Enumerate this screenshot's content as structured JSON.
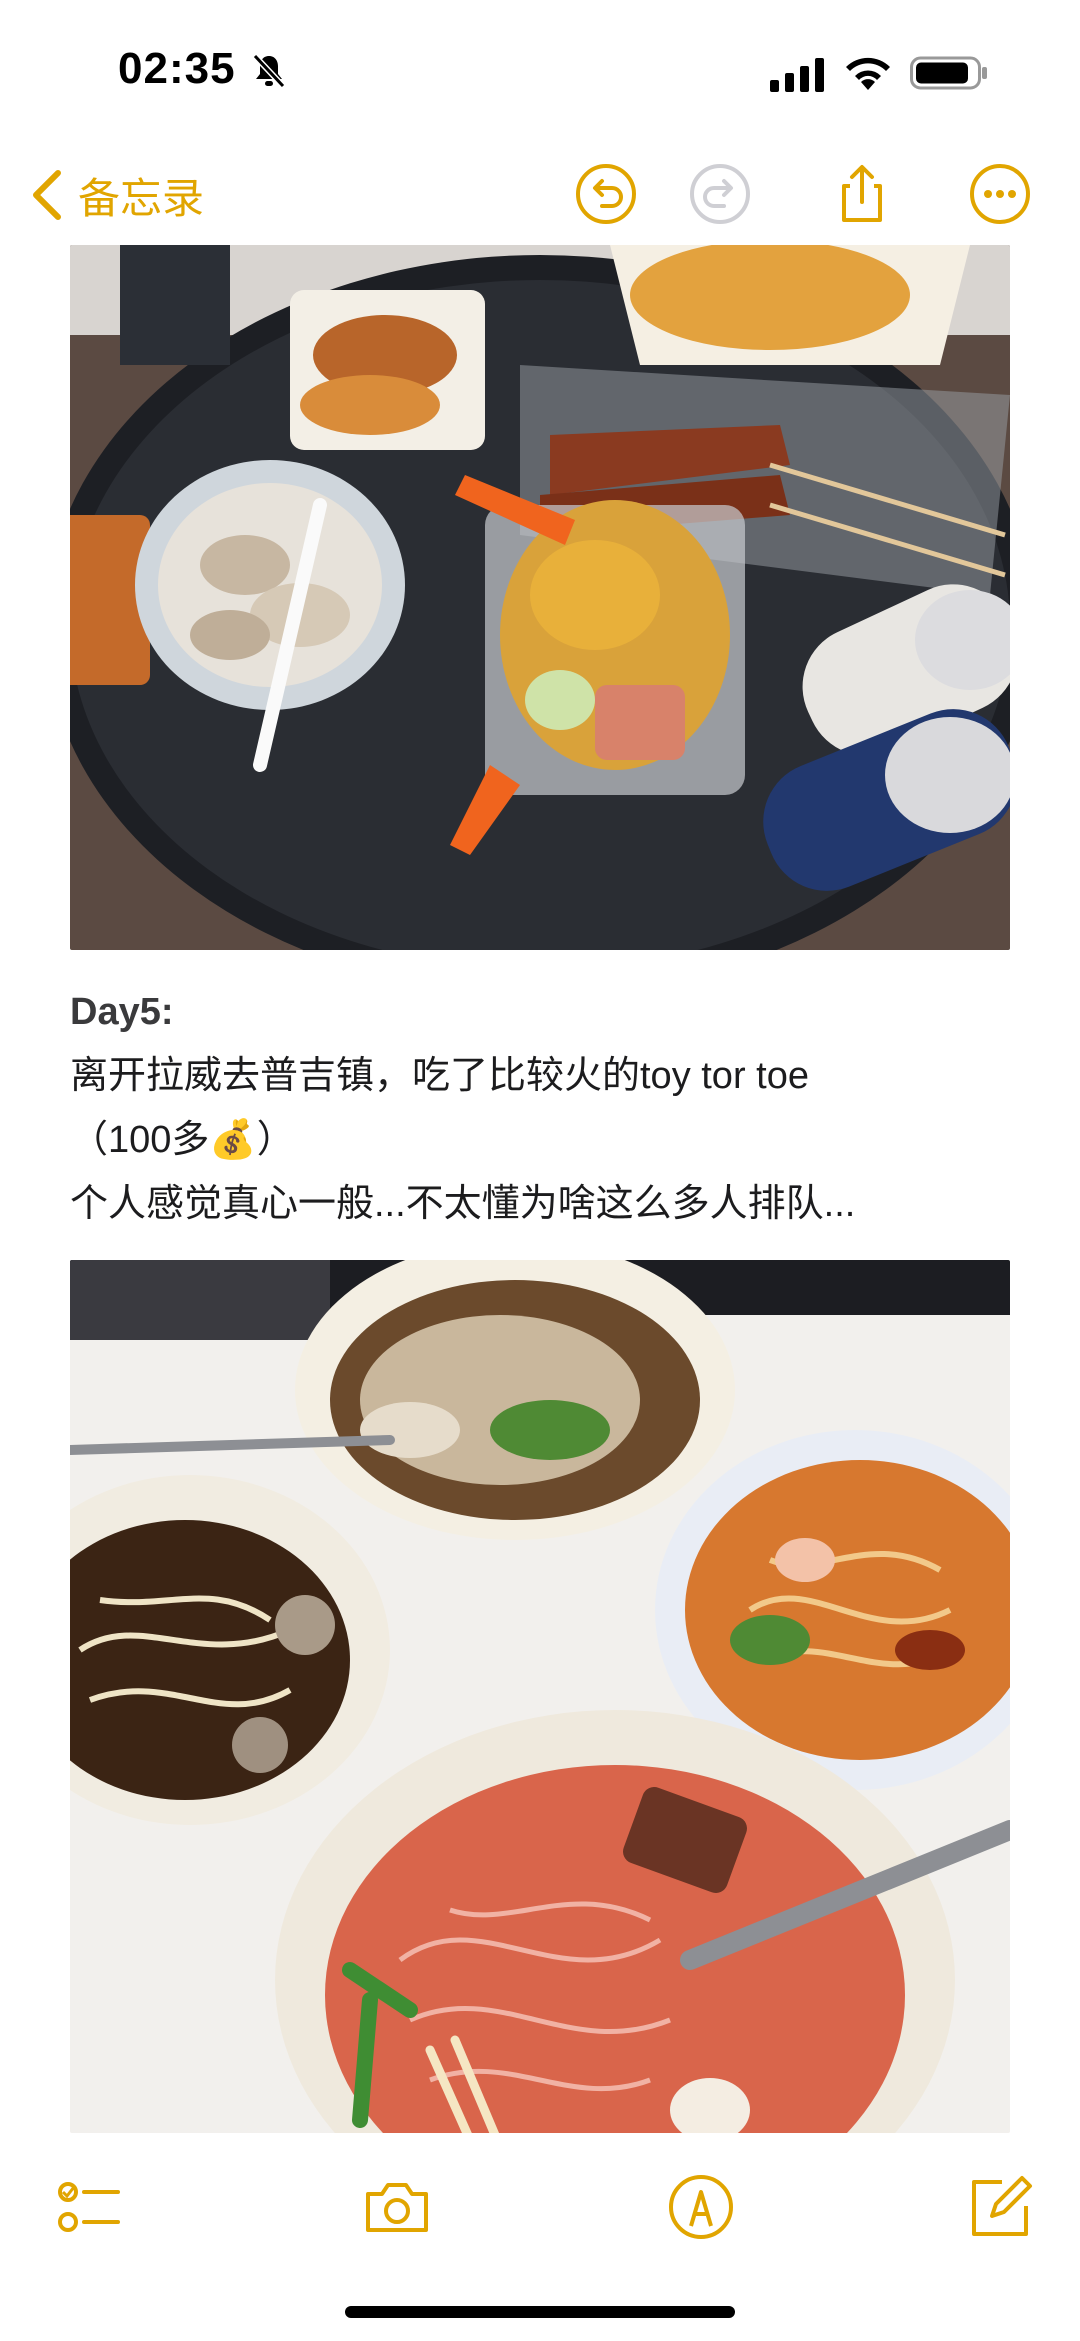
{
  "status_bar": {
    "time": "02:35"
  },
  "nav": {
    "back_label": "备忘录"
  },
  "note": {
    "heading": "Day5:",
    "line1": "离开拉威去普吉镇，吃了比较火的toy tor toe",
    "line2": "（100多💰）",
    "line3": "个人感觉真心一般...不太懂为啥这么多人排队..."
  },
  "colors": {
    "accent": "#e1a500",
    "text": "#1c1c1e",
    "background": "#ffffff"
  }
}
